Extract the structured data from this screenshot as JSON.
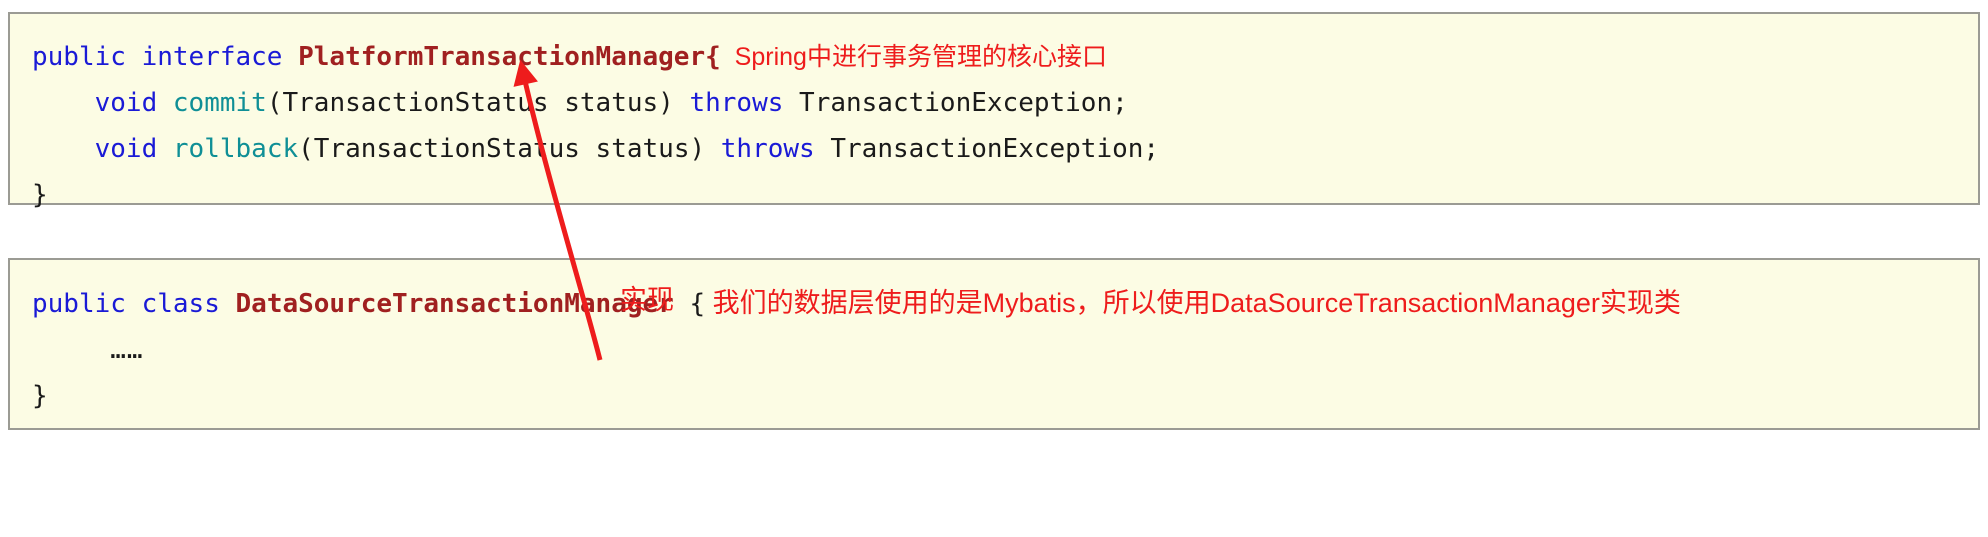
{
  "page": {
    "background": "#ffffff",
    "code_background": "#fcfce4",
    "border_color": "#9b9b94",
    "annotation_color": "#ee1c1c",
    "keyword_color": "#1a1ad6",
    "type_color": "#a02020",
    "method_color": "#0f8f96",
    "text_color": "#1a1a1a"
  },
  "interface_block": {
    "line1": {
      "kw_public": "public",
      "space1": " ",
      "kw_interface": "interface",
      "space2": " ",
      "type_name": "PlatformTransactionManager",
      "brace": "{",
      "annotation": "  Spring中进行事务管理的核心接口"
    },
    "line2": {
      "indent": "    ",
      "kw_void": "void",
      "space1": " ",
      "method": "commit",
      "params": "(TransactionStatus status) ",
      "kw_throws": "throws",
      "tail": " TransactionException;"
    },
    "line3": {
      "indent": "    ",
      "kw_void": "void",
      "space1": " ",
      "method": "rollback",
      "params": "(TransactionStatus status) ",
      "kw_throws": "throws",
      "tail": " TransactionException;"
    },
    "line4": {
      "close_brace": "}"
    }
  },
  "arrow": {
    "label": "实现",
    "color": "#ee1c1c"
  },
  "class_block": {
    "line1": {
      "kw_public": "public",
      "space1": " ",
      "kw_class": "class",
      "space2": " ",
      "type_name": "DataSourceTransactionManager",
      "brace": " {",
      "annotation": " 我们的数据层使用的是Mybatis，所以使用DataSourceTransactionManager实现类"
    },
    "line2": {
      "indent": "     ",
      "ellipsis": "……"
    },
    "line3": {
      "close_brace": "}"
    }
  }
}
